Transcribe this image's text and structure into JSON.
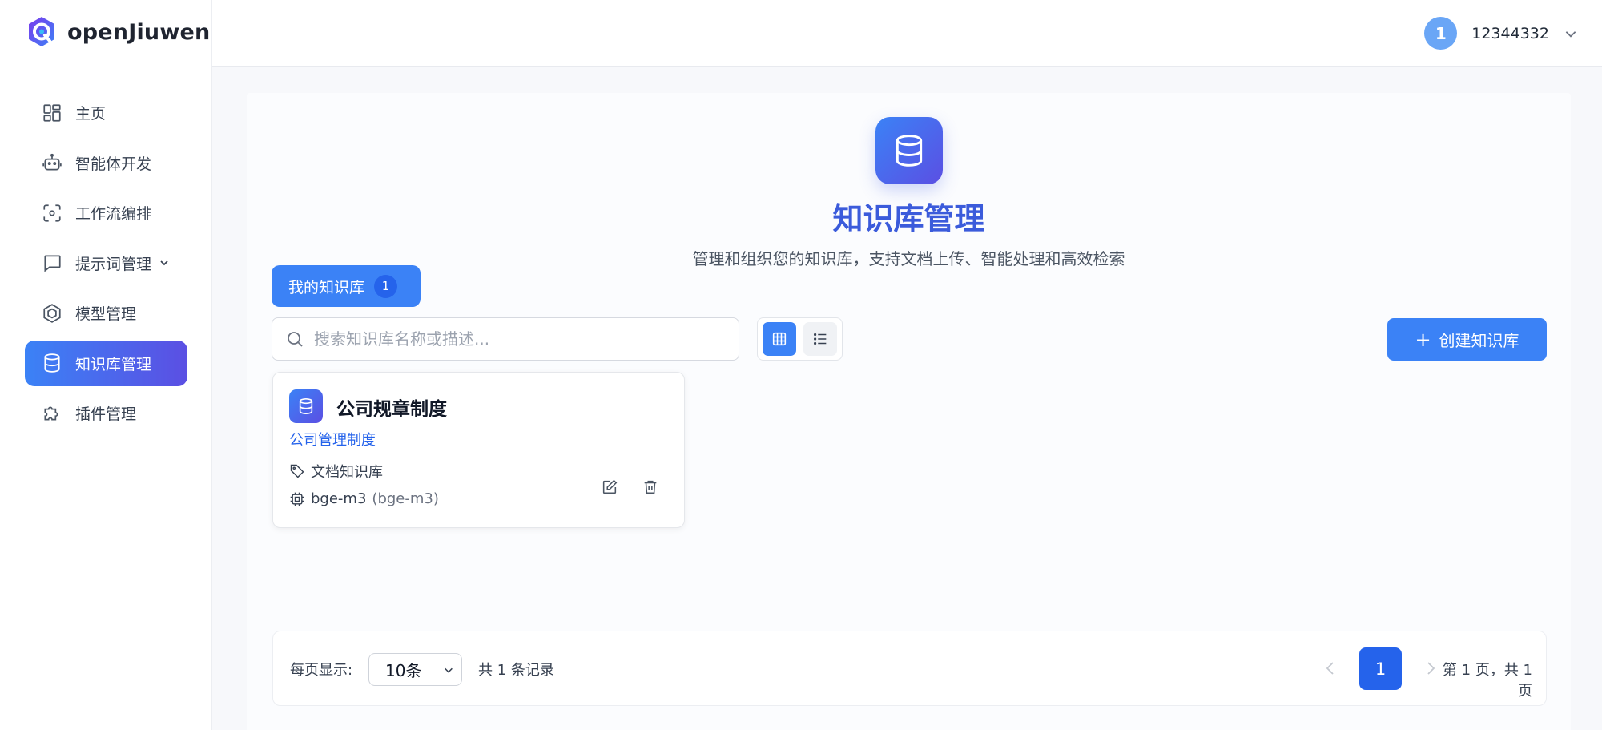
{
  "app": {
    "name": "openJiuwen"
  },
  "sidebar": {
    "items": [
      {
        "label": "主页",
        "icon": "dashboard-icon"
      },
      {
        "label": "智能体开发",
        "icon": "robot-icon"
      },
      {
        "label": "工作流编排",
        "icon": "workflow-icon"
      },
      {
        "label": "提示词管理",
        "icon": "chat-icon",
        "has_submenu": true
      },
      {
        "label": "模型管理",
        "icon": "model-icon"
      },
      {
        "label": "知识库管理",
        "icon": "database-icon",
        "active": true
      },
      {
        "label": "插件管理",
        "icon": "puzzle-icon"
      }
    ]
  },
  "topbar": {
    "user": {
      "avatar_text": "1",
      "name": "12344332"
    }
  },
  "hero": {
    "title": "知识库管理",
    "subtitle": "管理和组织您的知识库，支持文档上传、智能处理和高效检索"
  },
  "tabs": [
    {
      "label": "我的知识库",
      "count": "1"
    }
  ],
  "search": {
    "value": "",
    "placeholder": "搜索知识库名称或描述..."
  },
  "view_toggle": {
    "active": "grid"
  },
  "create_button": {
    "label": "创建知识库"
  },
  "cards": [
    {
      "title": "公司规章制度",
      "description": "公司管理制度",
      "type": "文档知识库",
      "model_name": "bge-m3",
      "model_id": "(bge-m3)"
    }
  ],
  "pagination": {
    "page_size_label": "每页显示:",
    "page_size": "10条",
    "total": "共 1 条记录",
    "current_page": "1",
    "info": "第 1 页，共 1 页"
  },
  "colors": {
    "accent": "#3b82f6",
    "accent_gradient_end": "#5b4fe3",
    "title_blue": "#3b5bdb",
    "page_active": "#2563eb"
  }
}
